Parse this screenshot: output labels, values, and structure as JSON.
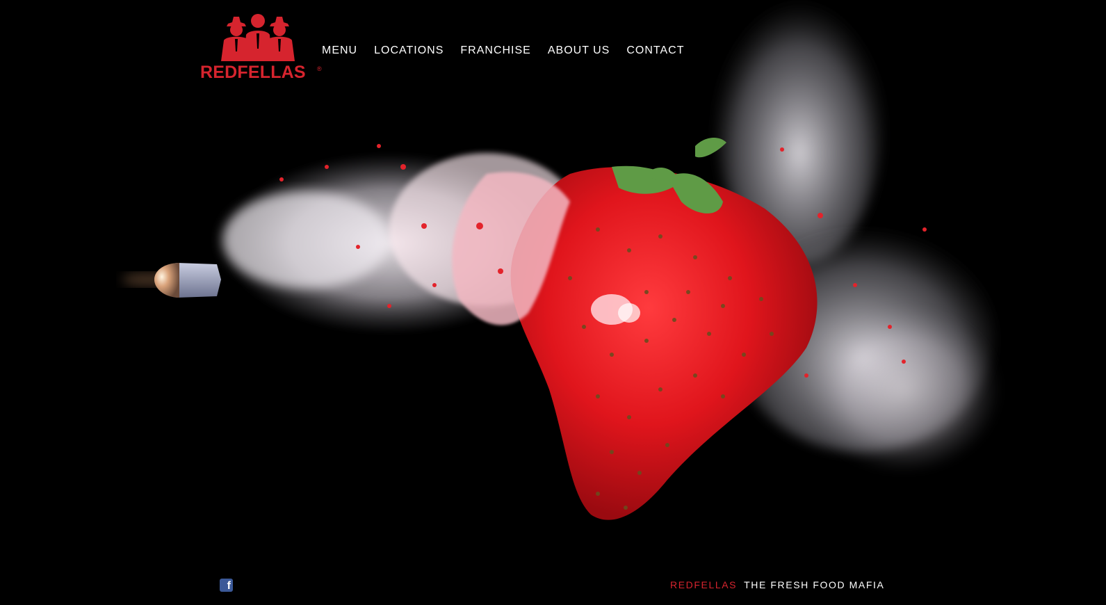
{
  "brand": {
    "name": "REDFELLAS",
    "registered_mark": "®",
    "color": "#d6242e"
  },
  "nav": {
    "items": [
      {
        "label": "MENU"
      },
      {
        "label": "LOCATIONS"
      },
      {
        "label": "FRANCHISE"
      },
      {
        "label": "ABOUT US"
      },
      {
        "label": "CONTACT"
      }
    ]
  },
  "hero": {
    "subject": "strawberry-bullet-impact-photo",
    "background": "#000000"
  },
  "footer": {
    "social_icon": "facebook-icon",
    "social_glyph": "f",
    "tagline_brand": "REDFELLAS",
    "tagline_text": "THE FRESH FOOD MAFIA"
  }
}
